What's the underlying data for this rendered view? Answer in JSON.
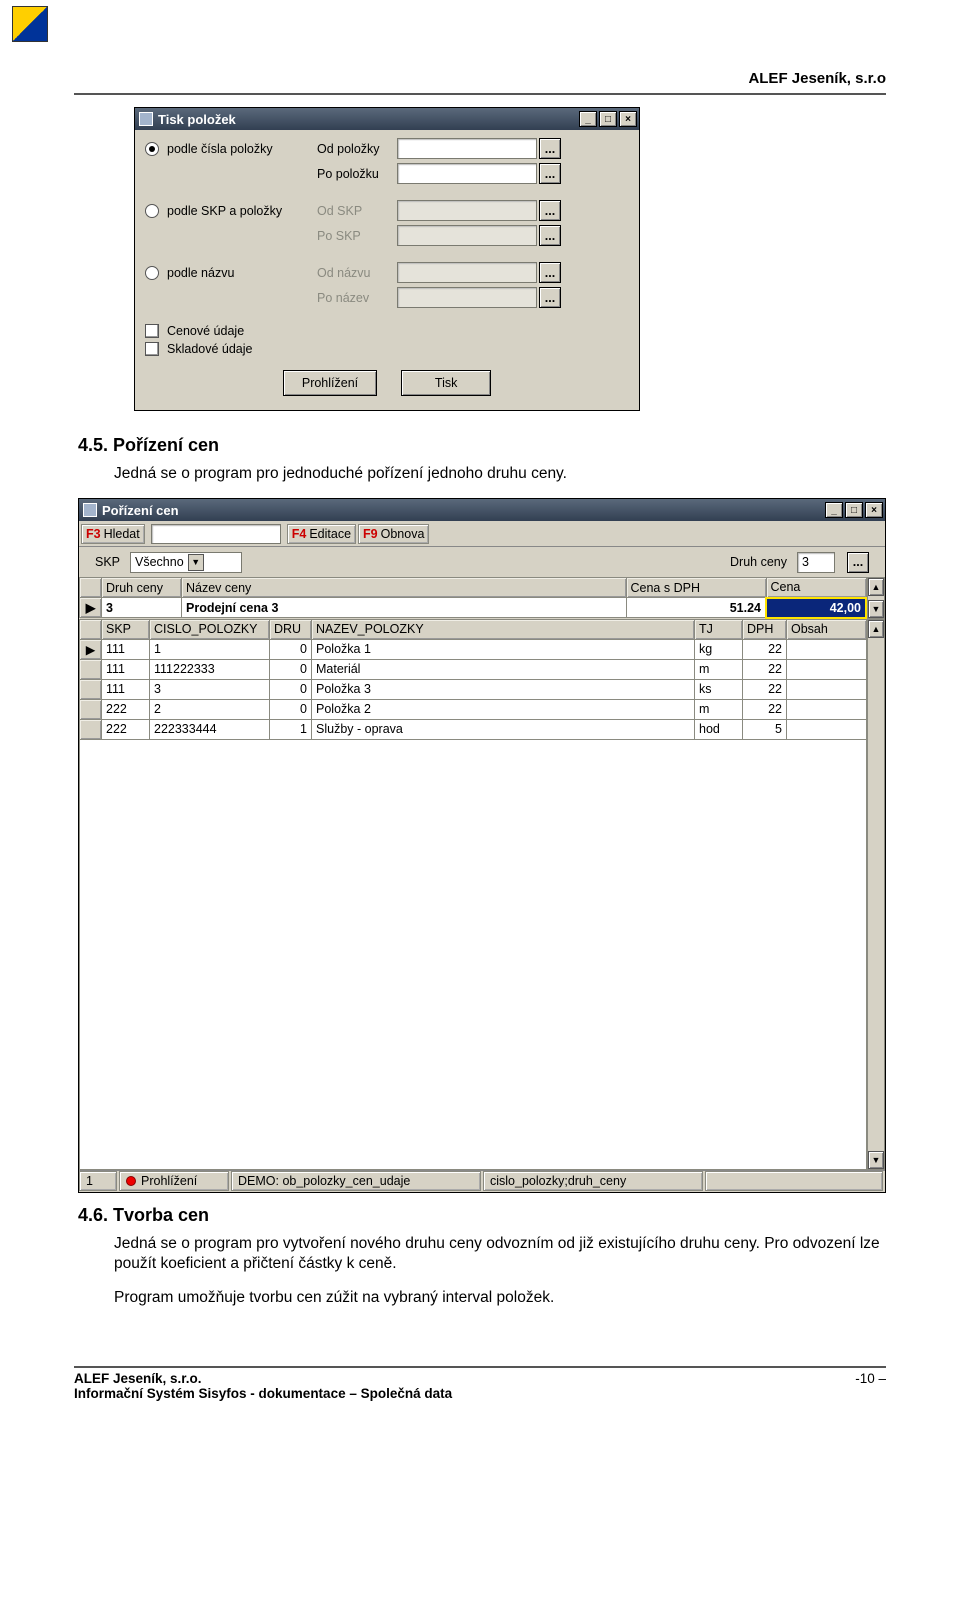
{
  "page_header": "ALEF Jeseník, s.r.o",
  "win1": {
    "title": "Tisk položek",
    "radio_cislo": "podle čísla položky",
    "radio_skp": "podle SKP a položky",
    "radio_nazvu": "podle názvu",
    "f_od_polozky": "Od položky",
    "f_po_polozku": "Po položku",
    "f_od_skp": "Od SKP",
    "f_po_skp": "Po SKP",
    "f_od_nazvu": "Od názvu",
    "f_po_nazev": "Po název",
    "chk_cenove": "Cenové údaje",
    "chk_skladove": "Skladové údaje",
    "btn_prohlizeni": "Prohlížení",
    "btn_tisk": "Tisk",
    "browse": "..."
  },
  "section45_title": "4.5. Pořízení cen",
  "section45_body": "Jedná  se  o program pro jednoduché pořízení jednoho druhu ceny.",
  "win2": {
    "title": "Pořízení cen",
    "f3": "F3",
    "f3_lbl": "Hledat",
    "f4": "F4",
    "f4_lbl": "Editace",
    "f9": "F9",
    "f9_lbl": "Obnova",
    "skp_lbl": "SKP",
    "skp_val": "Všechno",
    "druh_lbl": "Druh ceny",
    "druh_val": "3",
    "hdr_top": [
      "",
      "Druh ceny",
      "Název ceny",
      "Cena s DPH",
      "Cena"
    ],
    "row_top": [
      "▶",
      "3",
      "Prodejní cena 3",
      "51.24",
      "42,00"
    ],
    "hdr_bot": [
      "",
      "SKP",
      "CISLO_POLOZKY",
      "DRU",
      "NAZEV_POLOZKY",
      "TJ",
      "DPH",
      "Obsah"
    ],
    "rows_bot": [
      [
        "▶",
        "111",
        "1",
        "0",
        "Položka 1",
        "kg",
        "22",
        ""
      ],
      [
        "",
        "111",
        "111222333",
        "0",
        "Materiál",
        "m",
        "22",
        ""
      ],
      [
        "",
        "111",
        "3",
        "0",
        "Položka 3",
        "ks",
        "22",
        ""
      ],
      [
        "",
        "222",
        "2",
        "0",
        "Položka 2",
        "m",
        "22",
        ""
      ],
      [
        "",
        "222",
        "222333444",
        "1",
        "Služby - oprava",
        "hod",
        "5",
        ""
      ]
    ],
    "status": {
      "rec": "1",
      "mode": "Prohlížení",
      "ds": "DEMO: ob_polozky_cen_udaje",
      "sort": "cislo_polozky;druh_ceny"
    }
  },
  "section46_title": "4.6. Tvorba cen",
  "section46_body1": "Jedná se o program pro vytvoření nového druhu ceny odvozním od již existujícího druhu ceny. Pro odvození lze použít koeficient a přičtení částky k ceně.",
  "section46_body2": "Program umožňuje tvorbu cen zúžit na vybraný interval položek.",
  "footer": {
    "company": "ALEF Jeseník, s.r.o.",
    "subtitle": "Informační Systém Sisyfos - dokumentace – Společná data",
    "page": "-10 –"
  }
}
